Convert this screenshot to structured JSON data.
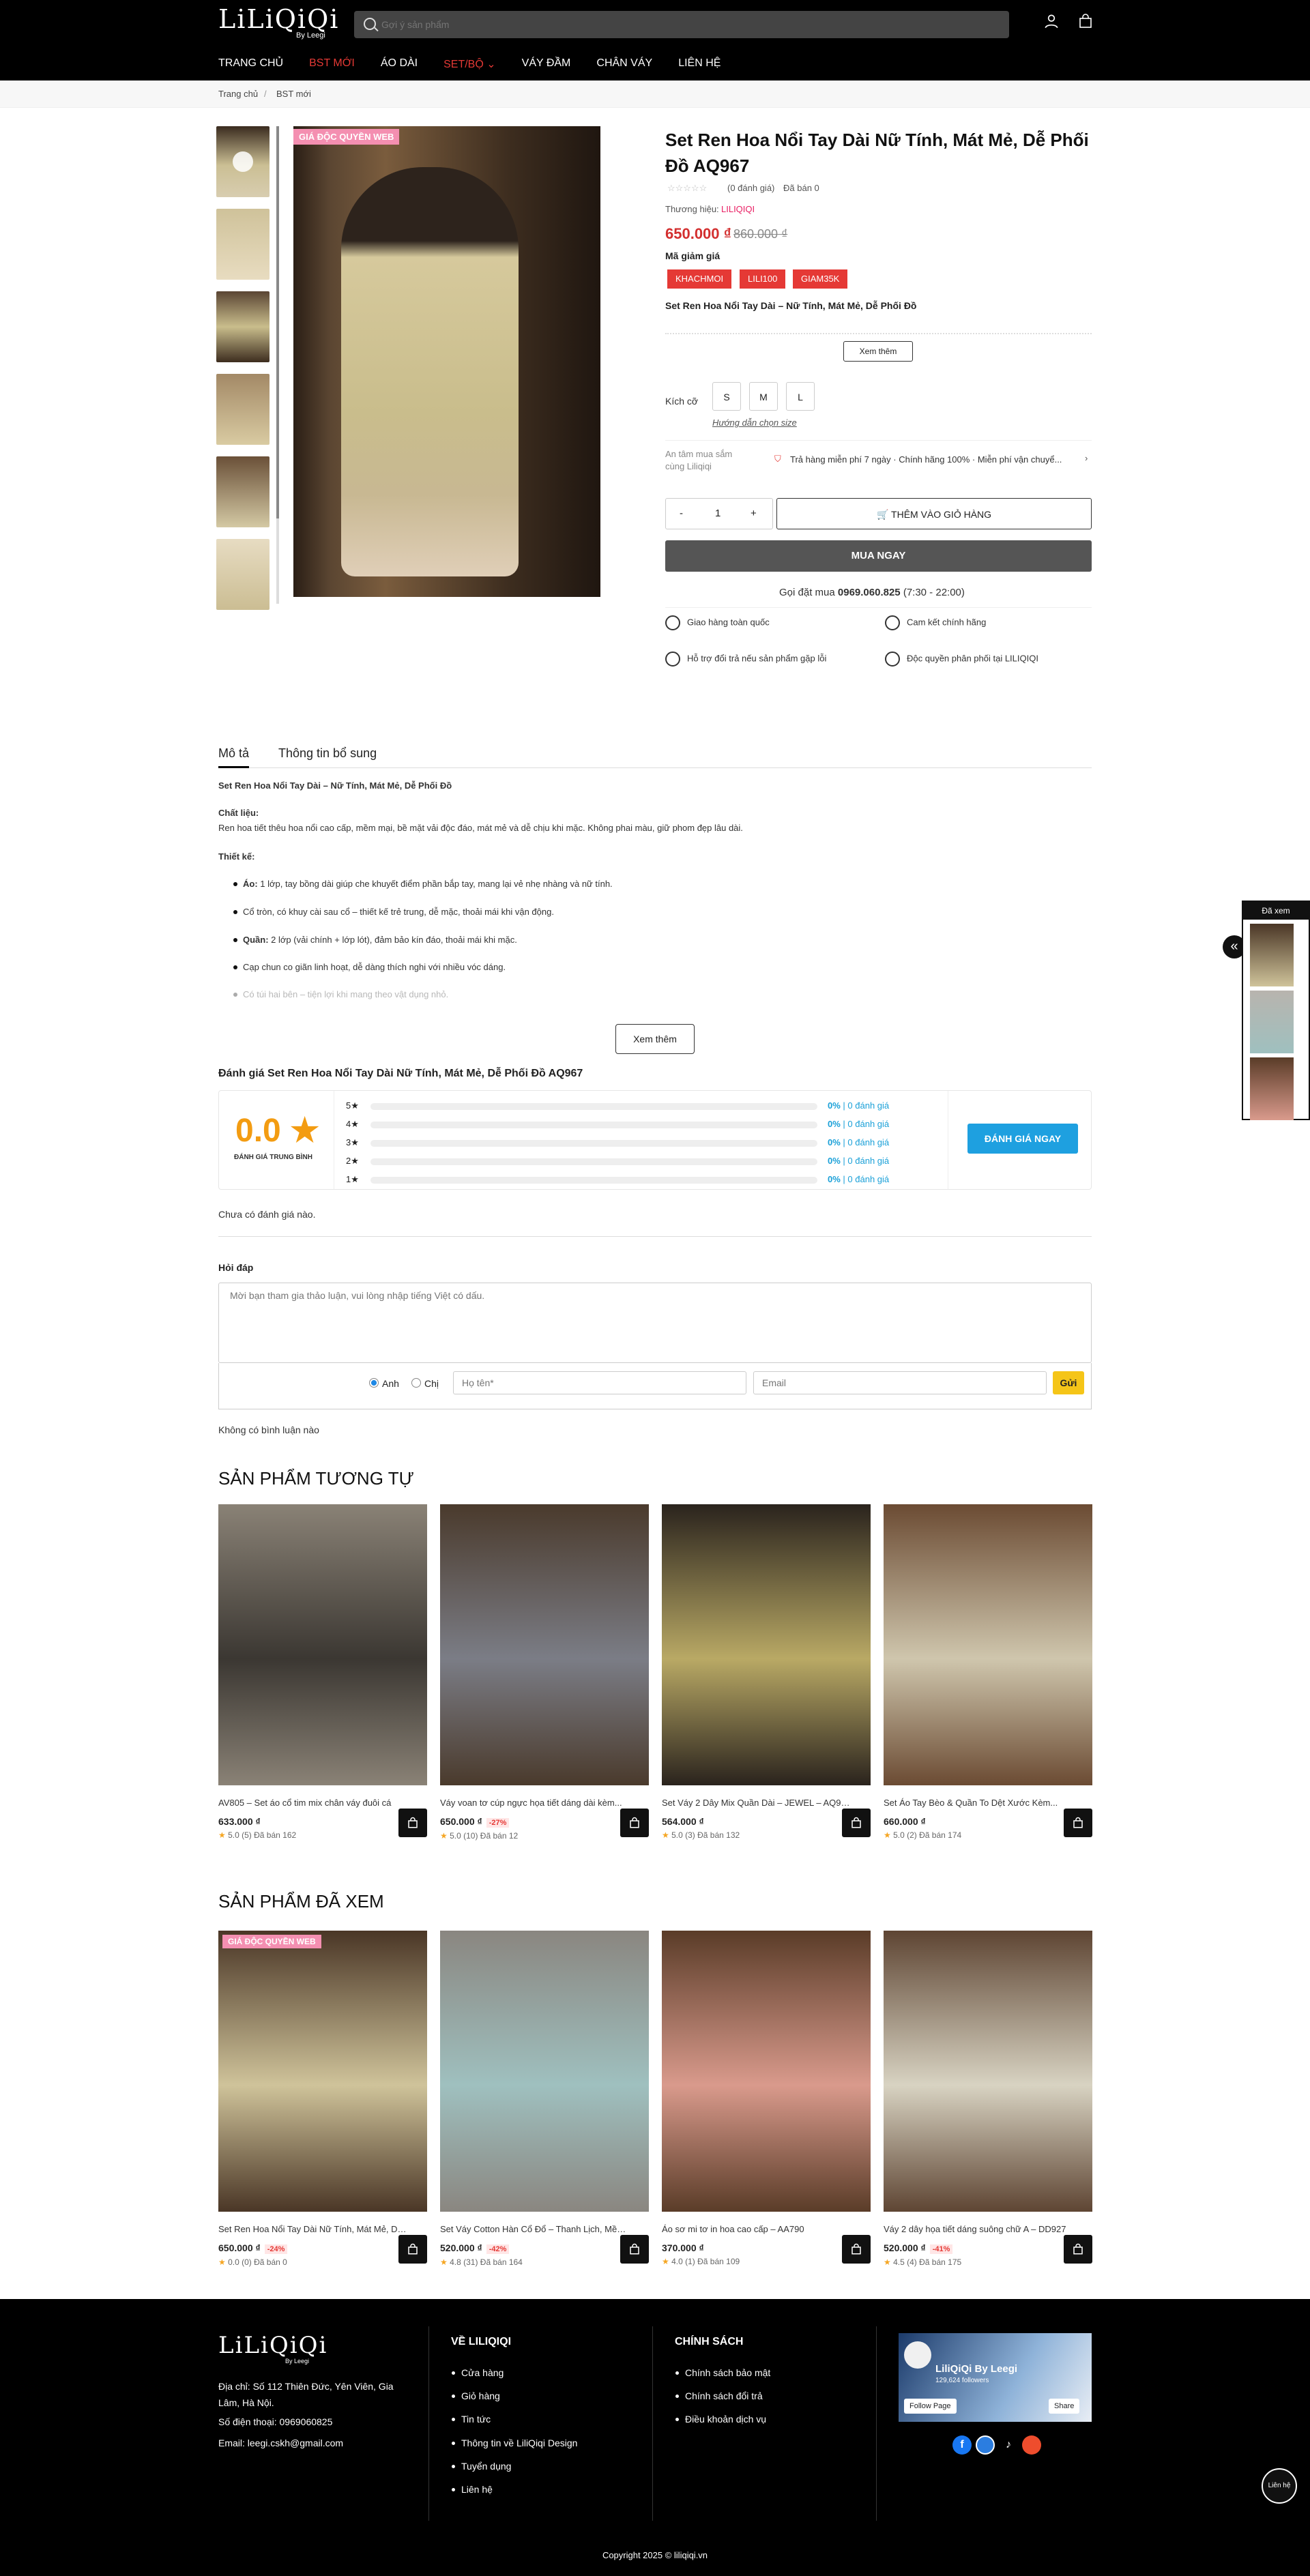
{
  "header": {
    "logo": "LiLiQiQi",
    "logo_sub": "By Leegi",
    "search_placeholder": "Gợi ý sản phẩm",
    "nav": [
      "TRANG CHỦ",
      "BST MỚI",
      "ÁO DÀI",
      "SET/BỘ",
      "VÁY ĐẦM",
      "CHÂN VÁY",
      "LIÊN HỆ"
    ],
    "nav_arrow": "⌄"
  },
  "breadcrumb": [
    "Trang chủ",
    "BST mới"
  ],
  "badge": "GIÁ ĐỘC QUYỀN WEB",
  "product": {
    "title": "Set Ren Hoa Nổi Tay Dài Nữ Tính, Mát Mẻ, Dễ Phối Đồ AQ967",
    "rating_text": "(0 đánh giá)",
    "sold": "Đã bán 0",
    "brand_label": "Thương hiệu:",
    "brand": "LILIQIQI",
    "price": "650.000 ₫",
    "old_price": "860.000 ₫",
    "coupon_label": "Mã giảm giá",
    "coupons": [
      "KHACHMOI",
      "LILI100",
      "GIAM35K"
    ],
    "subtitle": "Set Ren Hoa Nổi Tay Dài – Nữ Tính, Mát Mẻ, Dễ Phối Đồ",
    "see_more": "Xem thêm",
    "size_label": "Kích cỡ",
    "sizes": [
      "S",
      "M",
      "L"
    ],
    "size_guide": "Hướng dẫn chọn size",
    "assurance_label": "An tâm mua sắm cùng Liliqiqi",
    "assurance_text": "Trả hàng miễn phí 7 ngày · Chính hãng 100% · Miễn phí vận chuyể...",
    "qty": "1",
    "minus": "-",
    "plus": "+",
    "add_to_cart": "THÊM VÀO GIỎ HÀNG",
    "buy_now": "MUA NGAY",
    "hotline_prefix": "Gọi đặt mua",
    "hotline": "0969.060.825",
    "hotline_hours": "(7:30 - 22:00)",
    "features": [
      "Giao hàng toàn quốc",
      "Cam kết chính hãng",
      "Hỗ trợ đổi trả nếu sản phẩm gặp lỗi",
      "Độc quyền phân phối tại LILIQIQI"
    ]
  },
  "tabs": [
    "Mô tả",
    "Thông tin bổ sung"
  ],
  "description": {
    "heading": "Set Ren Hoa Nổi Tay Dài – Nữ Tính, Mát Mẻ, Dễ Phối Đồ",
    "material_label": "Chất liệu:",
    "material_text": "Ren hoa tiết thêu hoa nổi cao cấp, mềm mại, bề mặt vải độc đáo, mát mẻ và dễ chịu khi mặc. Không phai màu, giữ phom đẹp lâu dài.",
    "design_label": "Thiết kế:",
    "bullets": [
      {
        "b": "Áo:",
        "t": " 1 lớp, tay bồng dài giúp che khuyết điểm phần bắp tay, mang lại vẻ nhẹ nhàng và nữ tính."
      },
      {
        "b": "",
        "t": "Cổ tròn, có khuy cài sau cổ – thiết kế trẻ trung, dễ mặc, thoải mái khi vận động."
      },
      {
        "b": "Quần:",
        "t": " 2 lớp (vải chính + lớp lót), đảm bảo kín đáo, thoải mái khi mặc."
      },
      {
        "b": "",
        "t": "Cạp chun co giãn linh hoạt, dễ dàng thích nghi với nhiều vóc dáng."
      },
      {
        "b": "",
        "t": "Có túi hai bên – tiện lợi khi mang theo vật dụng nhỏ."
      }
    ],
    "see_more": "Xem thêm"
  },
  "reviews": {
    "title": "Đánh giá Set Ren Hoa Nổi Tay Dài Nữ Tính, Mát Mẻ, Dễ Phối Đồ AQ967",
    "avg": "0.0",
    "avg_label": "ĐÁNH GIÁ TRUNG BÌNH",
    "rows": [
      {
        "stars": "5",
        "pct": "0%",
        "count": "| 0 đánh giá"
      },
      {
        "stars": "4",
        "pct": "0%",
        "count": "| 0 đánh giá"
      },
      {
        "stars": "3",
        "pct": "0%",
        "count": "| 0 đánh giá"
      },
      {
        "stars": "2",
        "pct": "0%",
        "count": "| 0 đánh giá"
      },
      {
        "stars": "1",
        "pct": "0%",
        "count": "| 0 đánh giá"
      }
    ],
    "cta": "ĐÁNH GIÁ NGAY",
    "empty": "Chưa có đánh giá nào."
  },
  "qa": {
    "title": "Hỏi đáp",
    "placeholder": "Mời bạn tham gia thảo luận, vui lòng nhập tiếng Việt có dấu.",
    "opt1": "Anh",
    "opt2": "Chị",
    "name_placeholder": "Họ tên*",
    "email_placeholder": "Email",
    "send": "Gửi",
    "empty": "Không có bình luận nào"
  },
  "similar": {
    "title": "SẢN PHẨM TƯƠNG TỰ",
    "items": [
      {
        "name": "AV805 – Set áo cổ tim mix chân váy đuôi cá",
        "price": "633.000 ₫",
        "discount": "",
        "stats": "5.0 (5)   Đã bán 162",
        "c1": "#8a8276",
        "c2": "#3b3732"
      },
      {
        "name": "Váy voan tơ cúp ngực họa tiết dáng dài kèm...",
        "price": "650.000 ₫",
        "discount": "-27%",
        "stats": "5.0 (10)   Đã bán 12",
        "c1": "#4a3a2c",
        "c2": "#7b7d86"
      },
      {
        "name": "Set Váy 2 Dây Mix Quần Dài – JEWEL – AQ9324",
        "price": "564.000 ₫",
        "discount": "",
        "stats": "5.0 (3)   Đã bán 132",
        "c1": "#2a231d",
        "c2": "#b9a965"
      },
      {
        "name": "Set Áo Tay Bèo & Quần To Dệt Xước Kèm...",
        "price": "660.000 ₫",
        "discount": "",
        "stats": "5.0 (2)   Đã bán 174",
        "c1": "#6b4b33",
        "c2": "#cfc6ad"
      }
    ]
  },
  "viewed": {
    "title": "SẢN PHẨM ĐÃ XEM",
    "tag": "GIÁ ĐỘC QUYỀN WEB",
    "items": [
      {
        "name": "Set Ren Hoa Nổi Tay Dài Nữ Tính, Mát Mẻ, Dễ...",
        "price": "650.000 ₫",
        "discount": "-24%",
        "stats": "0.0 (0)   Đã bán 0",
        "c1": "#4a3626",
        "c2": "#cfc39a"
      },
      {
        "name": "Set Váy Cotton Hàn Cổ Đổ – Thanh Lịch, Mềm...",
        "price": "520.000 ₫",
        "discount": "-42%",
        "stats": "4.8 (31)   Đã bán 164",
        "c1": "#8a8680",
        "c2": "#9fc0bf"
      },
      {
        "name": "Áo sơ mi tơ in hoa cao cấp – AA790",
        "price": "370.000 ₫",
        "discount": "",
        "stats": "4.0 (1)   Đã bán 109",
        "c1": "#5a3c28",
        "c2": "#d99a8c"
      },
      {
        "name": "Váy 2 dây họa tiết dáng suông chữ A – DD927",
        "price": "520.000 ₫",
        "discount": "-41%",
        "stats": "4.5 (4)   Đã bán 175",
        "c1": "#5e4533",
        "c2": "#d8d3c2"
      }
    ]
  },
  "recently_viewed_widget": {
    "title": "Đã xem"
  },
  "footer": {
    "logo": "LiLiQiQi",
    "logo_sub": "By Leegi",
    "address": "Địa chỉ: Số 112 Thiên Đức, Yên Viên, Gia Lâm, Hà Nội.",
    "phone": "Số điện thoại: 0969060825",
    "email": "Email: leegi.cskh@gmail.com",
    "about_title": "VỀ LILIQIQI",
    "about_links": [
      "Cửa hàng",
      "Giỏ hàng",
      "Tin tức",
      "Thông tin về LiliQiqi Design",
      "Tuyển dụng",
      "Liên hệ"
    ],
    "policy_title": "CHÍNH SÁCH",
    "policy_links": [
      "Chính sách bảo mật",
      "Chính sách đổi trả",
      "Điều khoản dịch vụ"
    ],
    "fb_name": "LiliQiQi By Leegi",
    "fb_followers": "129,624 followers",
    "fb_follow": "Follow Page",
    "fb_share": "Share",
    "copyright": "Copyright 2025 © liliqiqi.vn",
    "chat_label": "Liên hệ"
  }
}
